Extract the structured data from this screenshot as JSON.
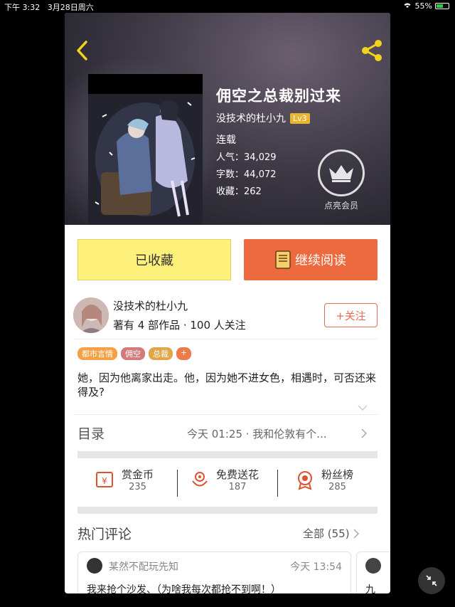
{
  "status_bar": {
    "time": "下午 3:32",
    "date": "3月28日周六",
    "battery": "55%"
  },
  "book": {
    "title": "佣空之总裁别过来",
    "author": "没技术的杜小九",
    "level": "Lv3",
    "status": "连载",
    "stats": [
      {
        "label": "人气：",
        "value": "34,029"
      },
      {
        "label": "字数：",
        "value": "44,072"
      },
      {
        "label": "收藏：",
        "value": "262"
      }
    ],
    "vip_label": "点亮会员"
  },
  "actions": {
    "favorited_label": "已收藏",
    "continue_label": "继续阅读"
  },
  "author_card": {
    "name": "没技术的杜小九",
    "meta": "著有 4 部作品 · 100 人关注",
    "follow_label": "+关注"
  },
  "tags": [
    {
      "label": "都市言情",
      "color": "#f5a045"
    },
    {
      "label": "佣空",
      "color": "#d37b7b"
    },
    {
      "label": "总裁",
      "color": "#e0a64a"
    },
    {
      "label": "+",
      "color": "#ee7a4a"
    }
  ],
  "description": "她，因为他离家出走。他，因为她不进女色，相遇时，可否还来得及?",
  "toc": {
    "label": "目录",
    "latest": "今天 01:25 · 我和伦敦有个..."
  },
  "interactions": [
    {
      "label": "赏金币",
      "count": "235",
      "icon": "reward-coin-icon"
    },
    {
      "label": "免费送花",
      "count": "187",
      "icon": "flower-icon"
    },
    {
      "label": "粉丝榜",
      "count": "285",
      "icon": "medal-icon"
    }
  ],
  "comments": {
    "title": "热门评论",
    "all_label": "全部 (55)",
    "items": [
      {
        "user": "某然不配玩先知",
        "time": "今天 13:54",
        "text": "我来抢个沙发、（为啥我每次都抢不到啊！）"
      },
      {
        "user": "",
        "time": "",
        "text": "九"
      }
    ]
  },
  "colors": {
    "accent_orange": "#ec6a3e",
    "fav_yellow": "#fdf07b",
    "level_gold": "#e9b530"
  }
}
